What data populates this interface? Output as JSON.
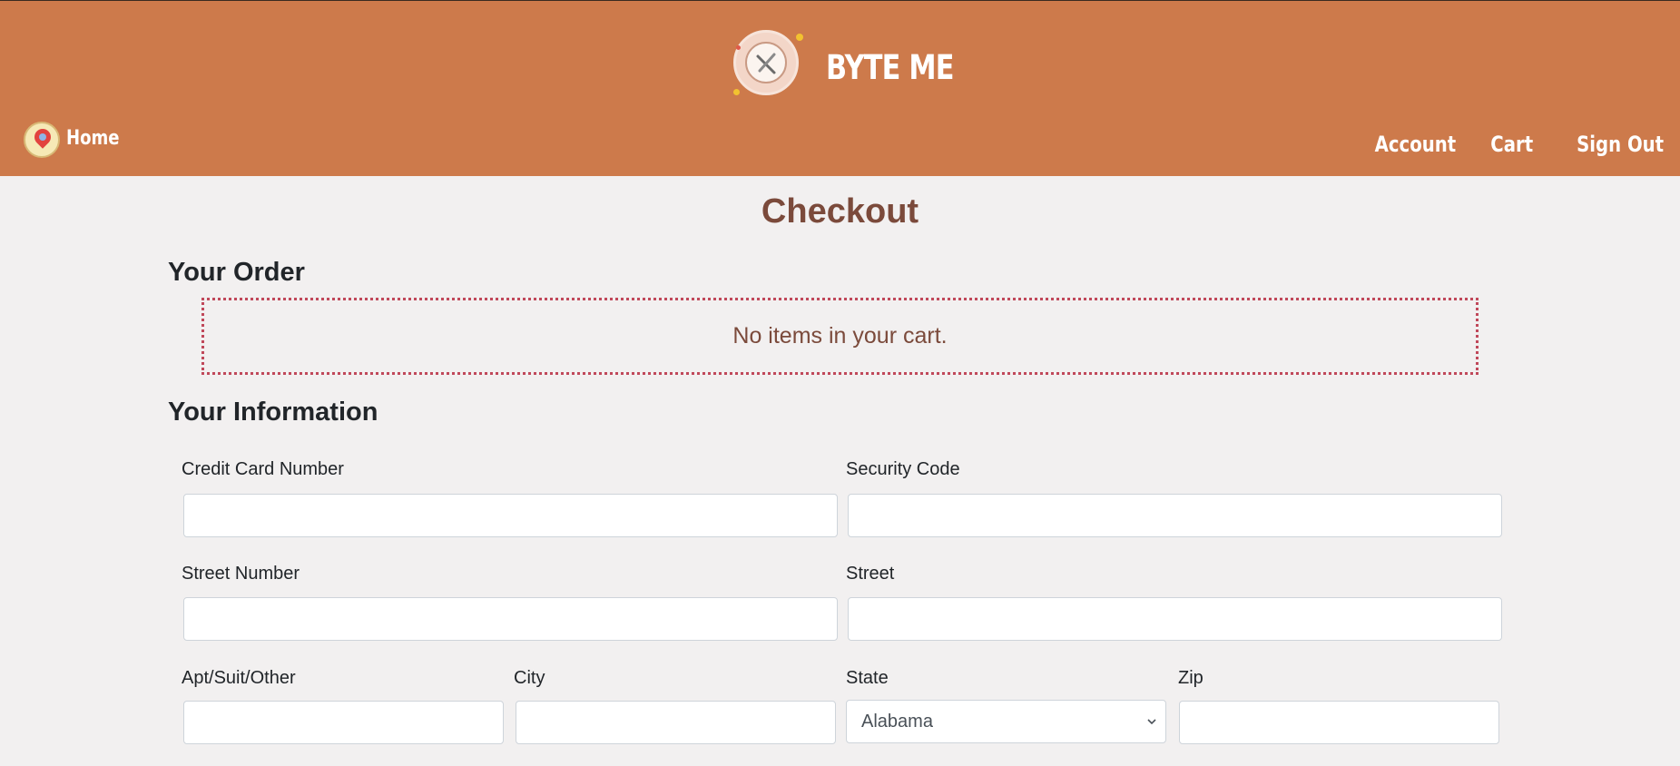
{
  "header": {
    "brand_name": "BYTE ME",
    "home_label": "Home",
    "nav": [
      "Account",
      "Cart",
      "Sign Out"
    ]
  },
  "page": {
    "title": "Checkout",
    "order_heading": "Your Order",
    "empty_cart_message": "No items in your cart.",
    "info_heading": "Your Information"
  },
  "form": {
    "credit_card_label": "Credit Card Number",
    "security_code_label": "Security Code",
    "street_number_label": "Street Number",
    "street_label": "Street",
    "apt_label": "Apt/Suit/Other",
    "city_label": "City",
    "state_label": "State",
    "state_value": "Alabama",
    "zip_label": "Zip"
  },
  "colors": {
    "header_bg": "#cd7a4b",
    "page_bg": "#f2f0f0",
    "title_color": "#7b4a3b",
    "order_border": "#c0485a"
  },
  "icons": {
    "brand": "plate-fork-icon",
    "home": "location-pin-icon",
    "select": "chevron-down-icon"
  }
}
